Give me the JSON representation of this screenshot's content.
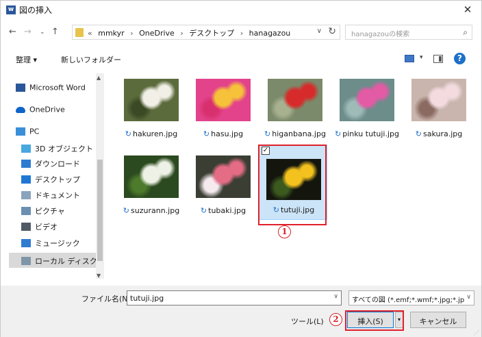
{
  "window": {
    "title": "図の挿入",
    "app_icon_letter": "w",
    "close_glyph": "✕"
  },
  "nav": {
    "back_glyph": "←",
    "forward_glyph": "→",
    "recent_glyph": "⌄",
    "up_glyph": "↑",
    "breadcrumbs": [
      "«",
      "mmkyr",
      "›",
      "OneDrive",
      "›",
      "デスクトップ",
      "›",
      "hanagazou"
    ],
    "dropdown_glyph": "∨",
    "refresh_glyph": "↻",
    "search_placeholder": "hanagazouの検索",
    "search_glyph": "⌕"
  },
  "toolbar": {
    "organize_label": "整理 ▾",
    "new_folder_label": "新しいフォルダー",
    "view_arrow": "▾",
    "help_label": "?"
  },
  "sidebar": {
    "items": [
      {
        "label": "Microsoft Word",
        "icon": "word-icon",
        "color": "#2b579a"
      },
      {
        "label": "OneDrive",
        "icon": "cloud-icon",
        "color": "#0f64c8"
      },
      {
        "label": "PC",
        "icon": "pc-icon",
        "color": "#3a8fd9"
      },
      {
        "label": "3D オブジェクト",
        "icon": "cube-icon",
        "color": "#49a8e0"
      },
      {
        "label": "ダウンロード",
        "icon": "download-icon",
        "color": "#2e7bd1"
      },
      {
        "label": "デスクトップ",
        "icon": "desktop-icon",
        "color": "#1f77d4"
      },
      {
        "label": "ドキュメント",
        "icon": "document-icon",
        "color": "#8aa4bd"
      },
      {
        "label": "ピクチャ",
        "icon": "pictures-icon",
        "color": "#6a8fb1"
      },
      {
        "label": "ビデオ",
        "icon": "video-icon",
        "color": "#505a66"
      },
      {
        "label": "ミュージック",
        "icon": "music-icon",
        "color": "#2f7bd0"
      },
      {
        "label": "ローカル ディスク (C",
        "icon": "disk-icon",
        "color": "#7f95a8"
      }
    ]
  },
  "files": [
    {
      "name": "hakuren.jpg",
      "colors": [
        "#5c6b3c",
        "#f1efe6",
        "#3b4a24"
      ]
    },
    {
      "name": "hasu.jpg",
      "colors": [
        "#e2438b",
        "#f6c23a",
        "#d8306e"
      ]
    },
    {
      "name": "higanbana.jpg",
      "colors": [
        "#7b8a6a",
        "#d72a2a",
        "#a7b08f"
      ]
    },
    {
      "name": "pinku tutuji.jpg",
      "colors": [
        "#6c8d8a",
        "#e35aa5",
        "#9fbbb8"
      ]
    },
    {
      "name": "sakura.jpg",
      "colors": [
        "#c9b5ad",
        "#f3dbe0",
        "#8b6b61"
      ]
    },
    {
      "name": "suzurann.jpg",
      "colors": [
        "#2c4a1f",
        "#eef2e6",
        "#4e7a2c"
      ]
    },
    {
      "name": "tubaki.jpg",
      "colors": [
        "#3a3e33",
        "#e56c85",
        "#f5eaee"
      ]
    },
    {
      "name": "tutuji.jpg",
      "colors": [
        "#14160e",
        "#f4c21e",
        "#3c5a1e"
      ],
      "selected": true
    }
  ],
  "sync_glyph": "↻",
  "checkbox_glyph": "✓",
  "annotations": {
    "step1": "1",
    "step2": "2"
  },
  "bottom": {
    "filename_label": "ファイル名(N):",
    "filename_value": "tutuji.jpg",
    "filter_value": "すべての図 (*.emf;*.wmf;*.jpg;*.jp",
    "dropdown_glyph": "∨",
    "tools_label": "ツール(L)",
    "insert_label": "挿入(S)",
    "insert_drop_glyph": "▾",
    "cancel_label": "キャンセル",
    "grip": "⋰"
  },
  "colors": {
    "accent": "#0078d7",
    "annotation_red": "#e0202a",
    "selection": "#cce4f7"
  }
}
